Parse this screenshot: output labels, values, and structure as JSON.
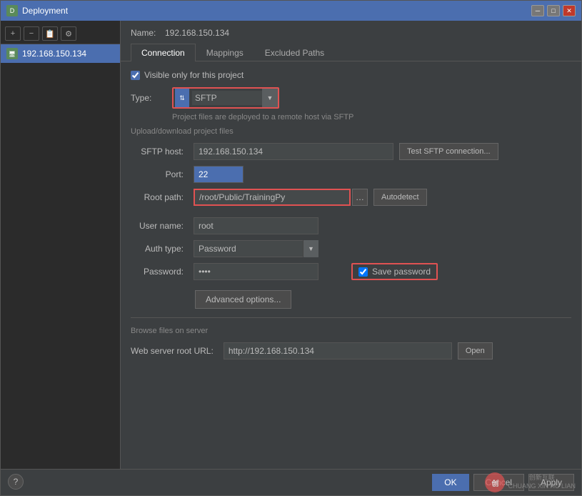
{
  "window": {
    "title": "Deployment",
    "title_icon": "D"
  },
  "sidebar": {
    "toolbar_buttons": [
      "+",
      "−",
      "📋",
      "⚙"
    ],
    "item": {
      "icon": "🖥",
      "label": "192.168.150.134"
    }
  },
  "name_row": {
    "label": "Name:",
    "value": "192.168.150.134"
  },
  "tabs": [
    {
      "label": "Connection"
    },
    {
      "label": "Mappings"
    },
    {
      "label": "Excluded Paths"
    }
  ],
  "active_tab": "Connection",
  "form": {
    "visible_only_label": "Visible only for this project",
    "type_label": "Type:",
    "type_value": "SFTP",
    "type_hint": "Project files are deployed to a remote host via SFTP",
    "upload_section_label": "Upload/download project files",
    "sftp_host_label": "SFTP host:",
    "sftp_host_value": "192.168.150.134",
    "test_btn_label": "Test SFTP connection...",
    "port_label": "Port:",
    "port_value": "22",
    "root_path_label": "Root path:",
    "root_path_value": "/root/Public/TrainingPy",
    "autodetect_btn_label": "Autodetect",
    "user_name_label": "User name:",
    "user_name_value": "root",
    "auth_type_label": "Auth type:",
    "auth_type_value": "Password",
    "password_label": "Password:",
    "password_value": "••••",
    "save_password_label": "Save password",
    "advanced_btn_label": "Advanced options...",
    "browse_section_label": "Browse files on server",
    "web_server_label": "Web server root URL:",
    "web_server_value": "http://192.168.150.134",
    "open_btn_label": "Open"
  },
  "buttons": {
    "ok": "OK",
    "cancel": "Cancel",
    "apply": "Apply",
    "help": "?"
  },
  "watermark": {
    "logo_text": "创",
    "line1": "创新互联",
    "line2": "CHUANG XIN HU LIAN"
  }
}
